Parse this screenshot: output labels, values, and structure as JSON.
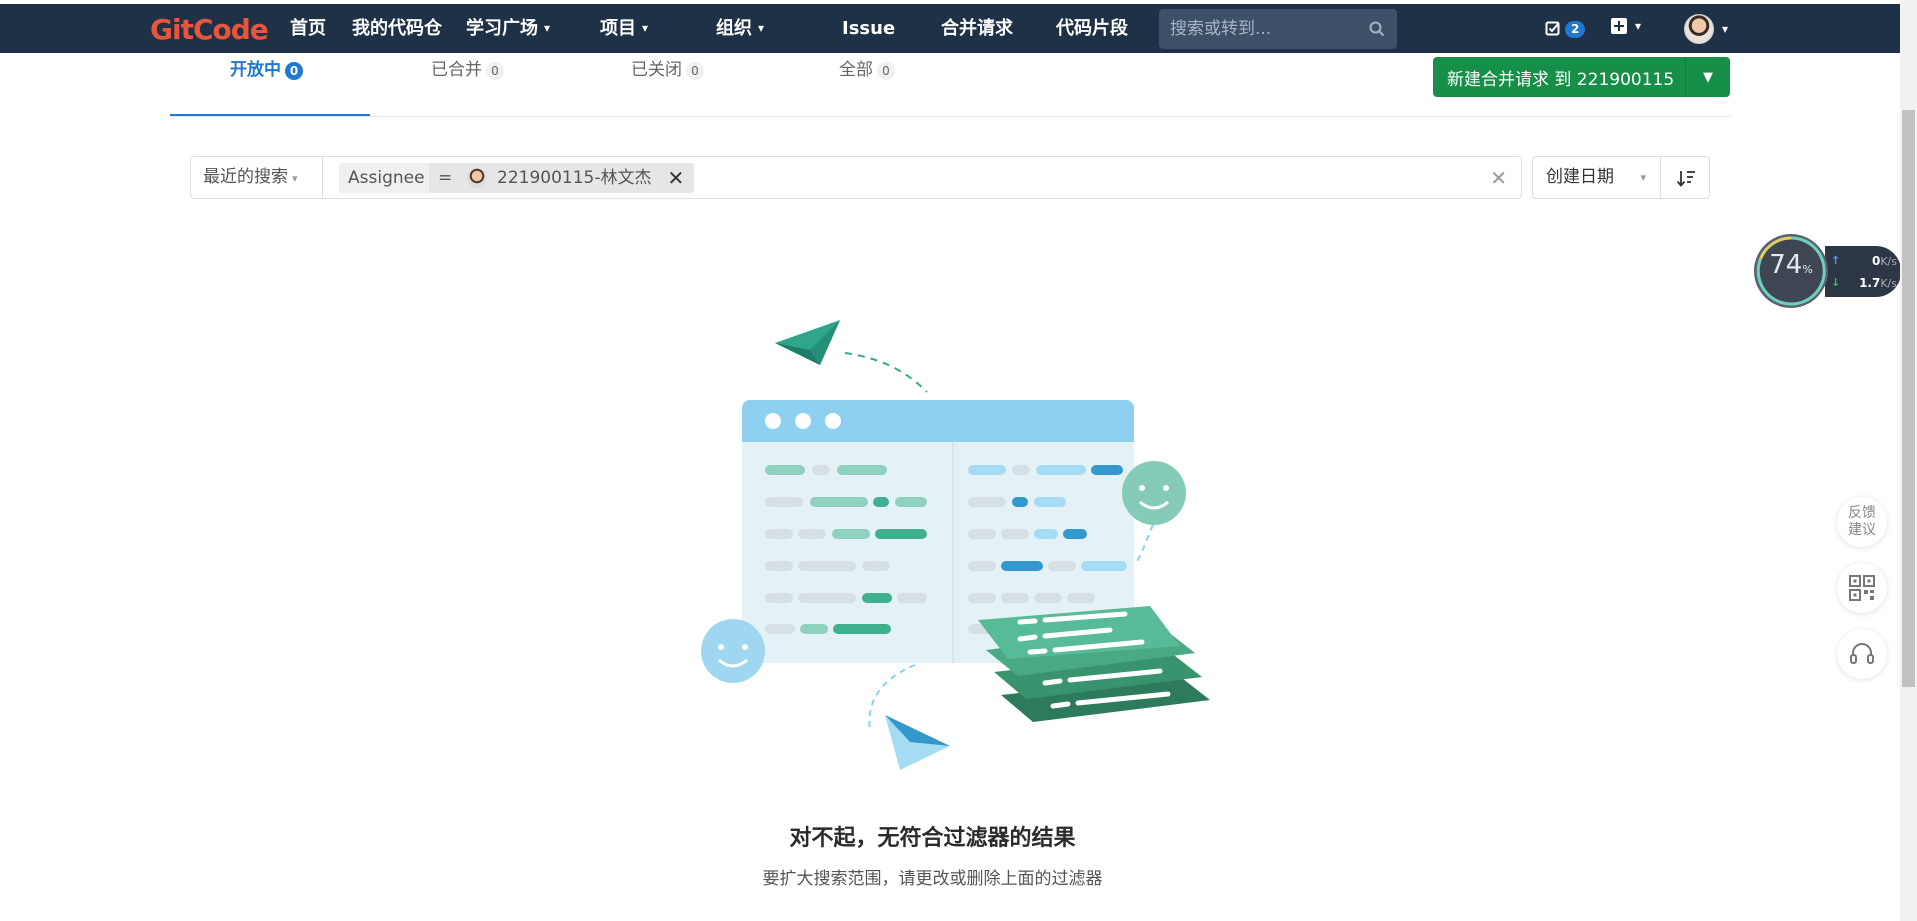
{
  "nav": {
    "logo": "GitCode",
    "items": [
      {
        "label": "首页",
        "dropdown": false
      },
      {
        "label": "我的代码仓",
        "dropdown": false
      },
      {
        "label": "学习广场",
        "dropdown": true
      },
      {
        "label": "项目",
        "dropdown": true
      },
      {
        "label": "组织",
        "dropdown": true
      },
      {
        "label": "Issue",
        "dropdown": false
      },
      {
        "label": "合并请求",
        "dropdown": false
      },
      {
        "label": "代码片段",
        "dropdown": false
      }
    ],
    "search_placeholder": "搜索或转到...",
    "todo_count": "2"
  },
  "tabs": [
    {
      "label": "开放中",
      "count": "0",
      "active": true
    },
    {
      "label": "已合并",
      "count": "0",
      "active": false
    },
    {
      "label": "已关闭",
      "count": "0",
      "active": false
    },
    {
      "label": "全部",
      "count": "0",
      "active": false
    }
  ],
  "new_mr_button": {
    "label": "新建合并请求 到 221900115"
  },
  "filter": {
    "recent_label": "最近的搜索",
    "token_name": "Assignee",
    "token_operator": "=",
    "token_value": "221900115-林文杰"
  },
  "sort": {
    "label": "创建日期"
  },
  "empty_state": {
    "title": "对不起，无符合过滤器的结果",
    "subtitle": "要扩大搜索范围，请更改或删除上面的过滤器"
  },
  "net_monitor": {
    "percent": "74",
    "percent_unit": "%",
    "upload": "0",
    "download": "1.7",
    "unit": "K/s"
  },
  "float_tools": {
    "feedback_line1": "反馈",
    "feedback_line2": "建议"
  },
  "colors": {
    "nav_bg": "#1f3146",
    "accent_blue": "#1f78d1",
    "brand_green": "#168f48",
    "logo_red": "#e8553c"
  }
}
